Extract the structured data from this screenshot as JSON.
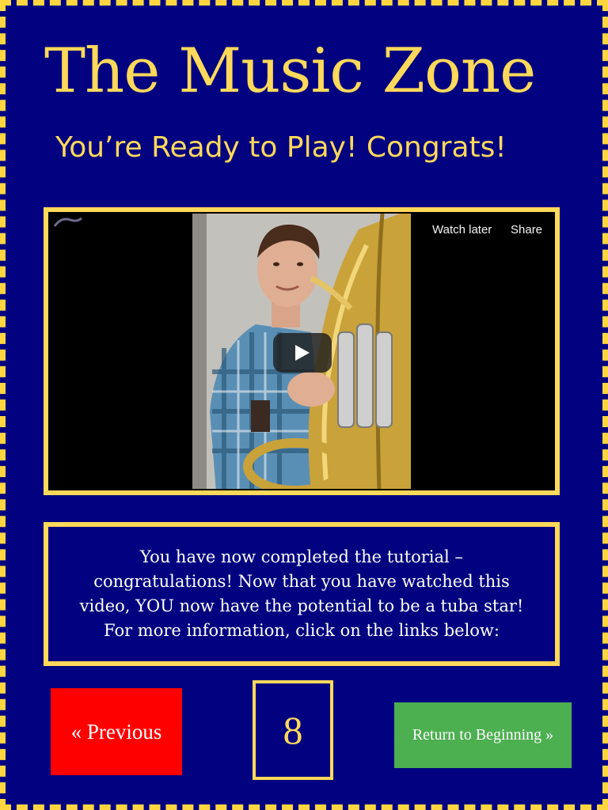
{
  "header": {
    "title": "The Music Zone",
    "subtitle": "You’re Ready to Play! Congrats!"
  },
  "video": {
    "watch_later_label": "Watch later",
    "share_label": "Share",
    "play_icon": "play-icon"
  },
  "message": {
    "text": "You have now completed the tutorial – congratulations! Now that you have watched this video, YOU now have the potential to be a tuba star! For more information, click on the links below:"
  },
  "navigation": {
    "previous_label": "« Previous",
    "page_number": "8",
    "return_label": "Return to Beginning »"
  },
  "colors": {
    "background": "#020280",
    "accent_yellow": "#ffd95a",
    "previous_button": "#ff0000",
    "return_button": "#4caf50"
  }
}
